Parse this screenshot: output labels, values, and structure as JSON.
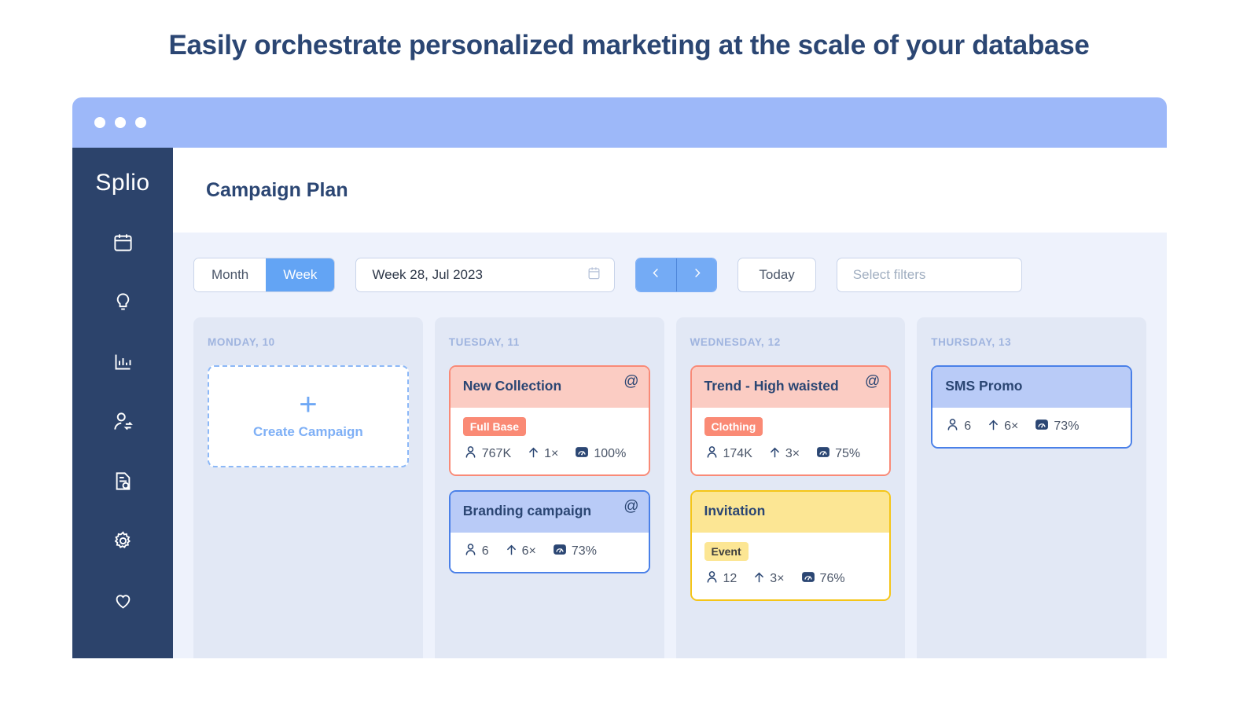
{
  "headline": "Easily orchestrate personalized marketing at the scale of your database",
  "window": {
    "dots": [
      "dot-1",
      "dot-2",
      "dot-3"
    ]
  },
  "sidebar": {
    "logo": "Splio",
    "items": [
      {
        "icon": "calendar-icon",
        "name": "sidebar-item-calendar"
      },
      {
        "icon": "lightbulb-icon",
        "name": "sidebar-item-insights"
      },
      {
        "icon": "bar-chart-icon",
        "name": "sidebar-item-analytics"
      },
      {
        "icon": "user-sync-icon",
        "name": "sidebar-item-contacts"
      },
      {
        "icon": "document-search-icon",
        "name": "sidebar-item-reports"
      },
      {
        "icon": "gear-icon",
        "name": "sidebar-item-settings"
      },
      {
        "icon": "heart-icon",
        "name": "sidebar-item-loyalty"
      }
    ]
  },
  "header": {
    "title": "Campaign Plan"
  },
  "toolbar": {
    "view_month": "Month",
    "view_week": "Week",
    "active_view": "Week",
    "date_label": "Week 28, Jul 2023",
    "calendar_icon": "calendar-icon",
    "prev_icon": "chevron-left-icon",
    "next_icon": "chevron-right-icon",
    "today_label": "Today",
    "filters_placeholder": "Select filters"
  },
  "create_card": {
    "plus": "+",
    "label": "Create Campaign"
  },
  "colors": {
    "accent_blue": "#63A4F4",
    "navy": "#2B4673",
    "sidebar_bg": "#2C436B",
    "titlebar": "#9DB8F9",
    "column_bg": "#E2E8F5",
    "coral_border": "#F98A77",
    "coral_header": "#FBCCC3",
    "blue_border": "#4A80E8",
    "blue_header": "#B9CBF7",
    "yellow_border": "#F5C518",
    "yellow_header": "#FCE694"
  },
  "columns": [
    {
      "day_label": "MONDAY, 10",
      "has_create": true,
      "cards": []
    },
    {
      "day_label": "TUESDAY, 11",
      "has_create": false,
      "cards": [
        {
          "title": "New Collection",
          "color": "coral",
          "has_at": true,
          "at": "@",
          "tag": "Full Base",
          "audience": "767K",
          "frequency": "1×",
          "score": "100%"
        },
        {
          "title": "Branding campaign",
          "color": "blue",
          "has_at": true,
          "at": "@",
          "tag": null,
          "audience": "6",
          "frequency": "6×",
          "score": "73%"
        }
      ]
    },
    {
      "day_label": "WEDNESDAY, 12",
      "has_create": false,
      "cards": [
        {
          "title": "Trend - High waisted",
          "color": "coral",
          "has_at": true,
          "at": "@",
          "tag": "Clothing",
          "audience": "174K",
          "frequency": "3×",
          "score": "75%"
        },
        {
          "title": "Invitation",
          "color": "yellow",
          "has_at": false,
          "at": "",
          "tag": "Event",
          "audience": "12",
          "frequency": "3×",
          "score": "76%"
        }
      ]
    },
    {
      "day_label": "THURSDAY, 13",
      "has_create": false,
      "cards": [
        {
          "title": "SMS Promo",
          "color": "blue",
          "has_at": false,
          "at": "",
          "tag": null,
          "audience": "6",
          "frequency": "6×",
          "score": "73%"
        }
      ]
    }
  ],
  "stat_icons": {
    "audience": "person-icon",
    "frequency": "arrow-up-icon",
    "score": "gauge-icon"
  }
}
